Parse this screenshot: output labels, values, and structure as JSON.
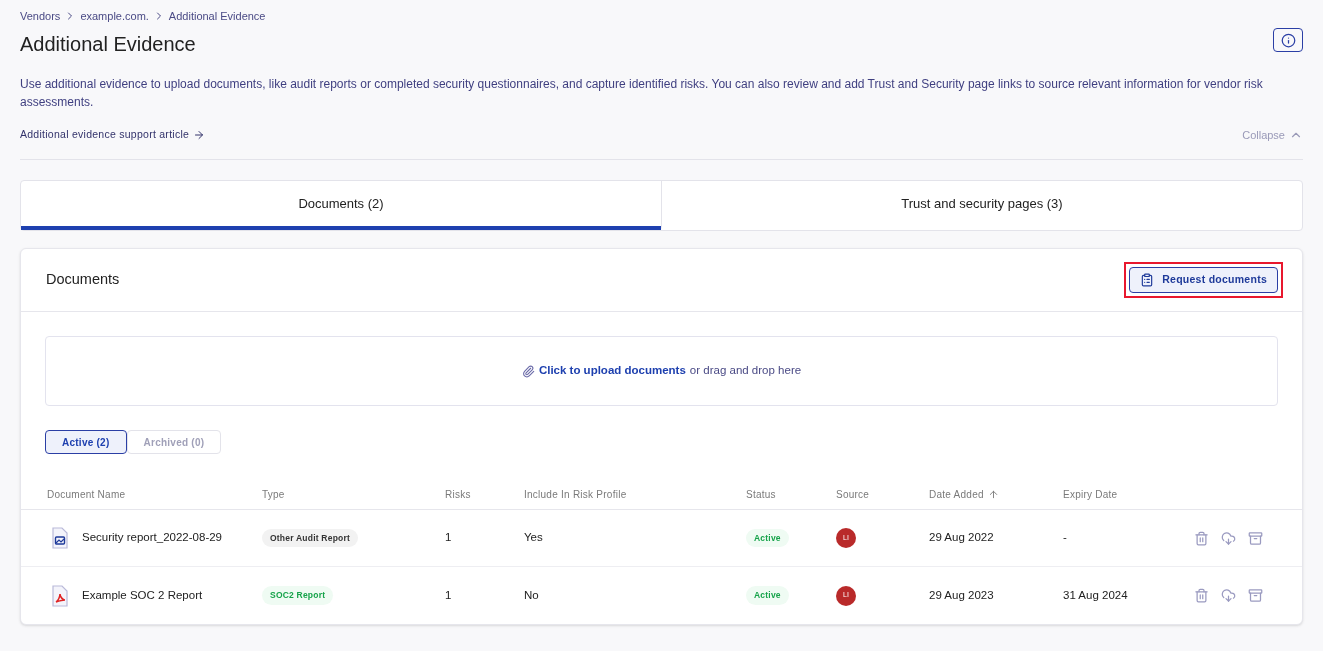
{
  "breadcrumbs": [
    "Vendors",
    "example.com.",
    "Additional Evidence"
  ],
  "title": "Additional Evidence",
  "description": "Use additional evidence to upload documents, like audit reports or completed security questionnaires, and capture identified risks. You can also review and add Trust and Security page links to source relevant information for vendor risk assessments.",
  "support_link": "Additional evidence support article",
  "collapse": "Collapse",
  "tabs": [
    {
      "label": "Documents (2)",
      "selected": true
    },
    {
      "label": "Trust and security pages (3)",
      "selected": false
    }
  ],
  "panel": {
    "title": "Documents",
    "request_button": "Request documents",
    "highlighted": true
  },
  "upload": {
    "link": "Click to upload documents",
    "rest": "or drag and drop here"
  },
  "filters": [
    {
      "label": "Active (2)",
      "selected": true
    },
    {
      "label": "Archived (0)",
      "selected": false
    }
  ],
  "table": {
    "columns": [
      {
        "label": "Document Name",
        "sorted": false
      },
      {
        "label": "Type",
        "sorted": false
      },
      {
        "label": "Risks",
        "sorted": false
      },
      {
        "label": "Include In Risk Profile",
        "sorted": false
      },
      {
        "label": "Status",
        "sorted": false
      },
      {
        "label": "Source",
        "sorted": false
      },
      {
        "label": "Date Added",
        "sorted": true
      },
      {
        "label": "Expiry Date",
        "sorted": false
      }
    ],
    "rows": [
      {
        "kind": "image",
        "name": "Security report_2022-08-29",
        "type": {
          "label": "Other Audit Report",
          "kind": "neutral"
        },
        "risks": "1",
        "include": "Yes",
        "status": "Active",
        "source": "LI",
        "date_added": "29 Aug 2022",
        "expiry": "-"
      },
      {
        "kind": "pdf",
        "name": "Example SOC 2 Report",
        "type": {
          "label": "SOC2 Report",
          "kind": "success"
        },
        "risks": "1",
        "include": "No",
        "status": "Active",
        "source": "LI",
        "date_added": "29 Aug 2023",
        "expiry": "31 Aug 2024"
      }
    ]
  }
}
